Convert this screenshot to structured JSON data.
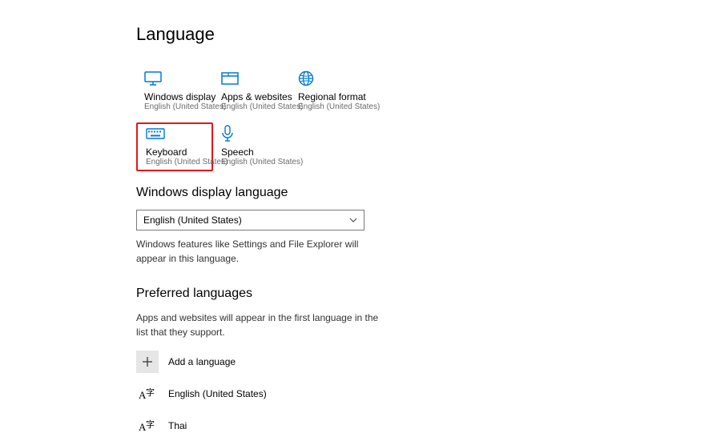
{
  "page": {
    "title": "Language"
  },
  "tiles": {
    "windows_display": {
      "label": "Windows display",
      "sub": "English (United States)"
    },
    "apps_websites": {
      "label": "Apps & websites",
      "sub": "English (United States)"
    },
    "regional_format": {
      "label": "Regional format",
      "sub": "English (United States)"
    },
    "keyboard": {
      "label": "Keyboard",
      "sub": "English (United States)"
    },
    "speech": {
      "label": "Speech",
      "sub": "English (United States)"
    }
  },
  "display_language": {
    "heading": "Windows display language",
    "selected": "English (United States)",
    "helper": "Windows features like Settings and File Explorer will appear in this language."
  },
  "preferred": {
    "heading": "Preferred languages",
    "helper": "Apps and websites will appear in the first language in the list that they support.",
    "add_label": "Add a language",
    "items": [
      {
        "label": "English (United States)"
      },
      {
        "label": "Thai"
      }
    ]
  },
  "colors": {
    "accent": "#0078d4",
    "highlight_border": "#e11818"
  }
}
